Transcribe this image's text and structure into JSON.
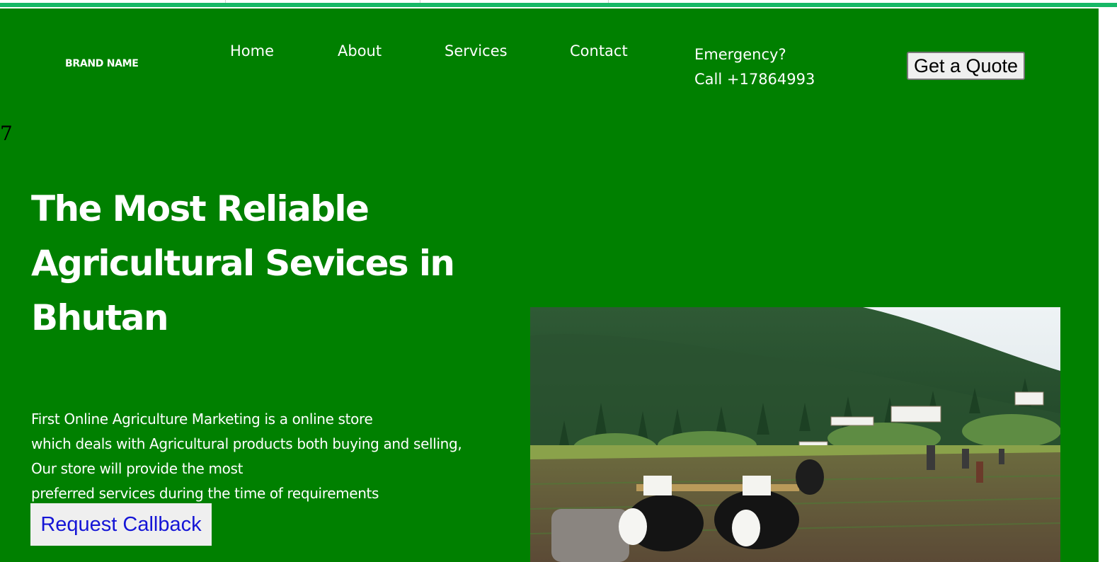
{
  "header": {
    "brand": "BRAND NAME",
    "nav": [
      {
        "label": "Home"
      },
      {
        "label": "About"
      },
      {
        "label": "Services"
      },
      {
        "label": "Contact"
      }
    ],
    "emergency": {
      "line1": "Emergency?",
      "line2": "Call +17864993"
    },
    "quote_button": "Get a Quote"
  },
  "stray_text": "7",
  "hero": {
    "title": "The Most Reliable Agricultural Sevices in Bhutan",
    "paragraph_lines": [
      "First Online Agriculture Marketing is a online store",
      "which deals with Agricultural products both buying and selling,",
      "Our store will provide the most",
      "preferred services during the time of requirements"
    ],
    "callback_button": "Request Callback",
    "image_alt": "Farmers ploughing a field with oxen in a Bhutanese valley"
  },
  "colors": {
    "page_background": "#008000",
    "top_bar": "#17b866",
    "text": "#ffffff",
    "callback_text": "#1515d6"
  }
}
